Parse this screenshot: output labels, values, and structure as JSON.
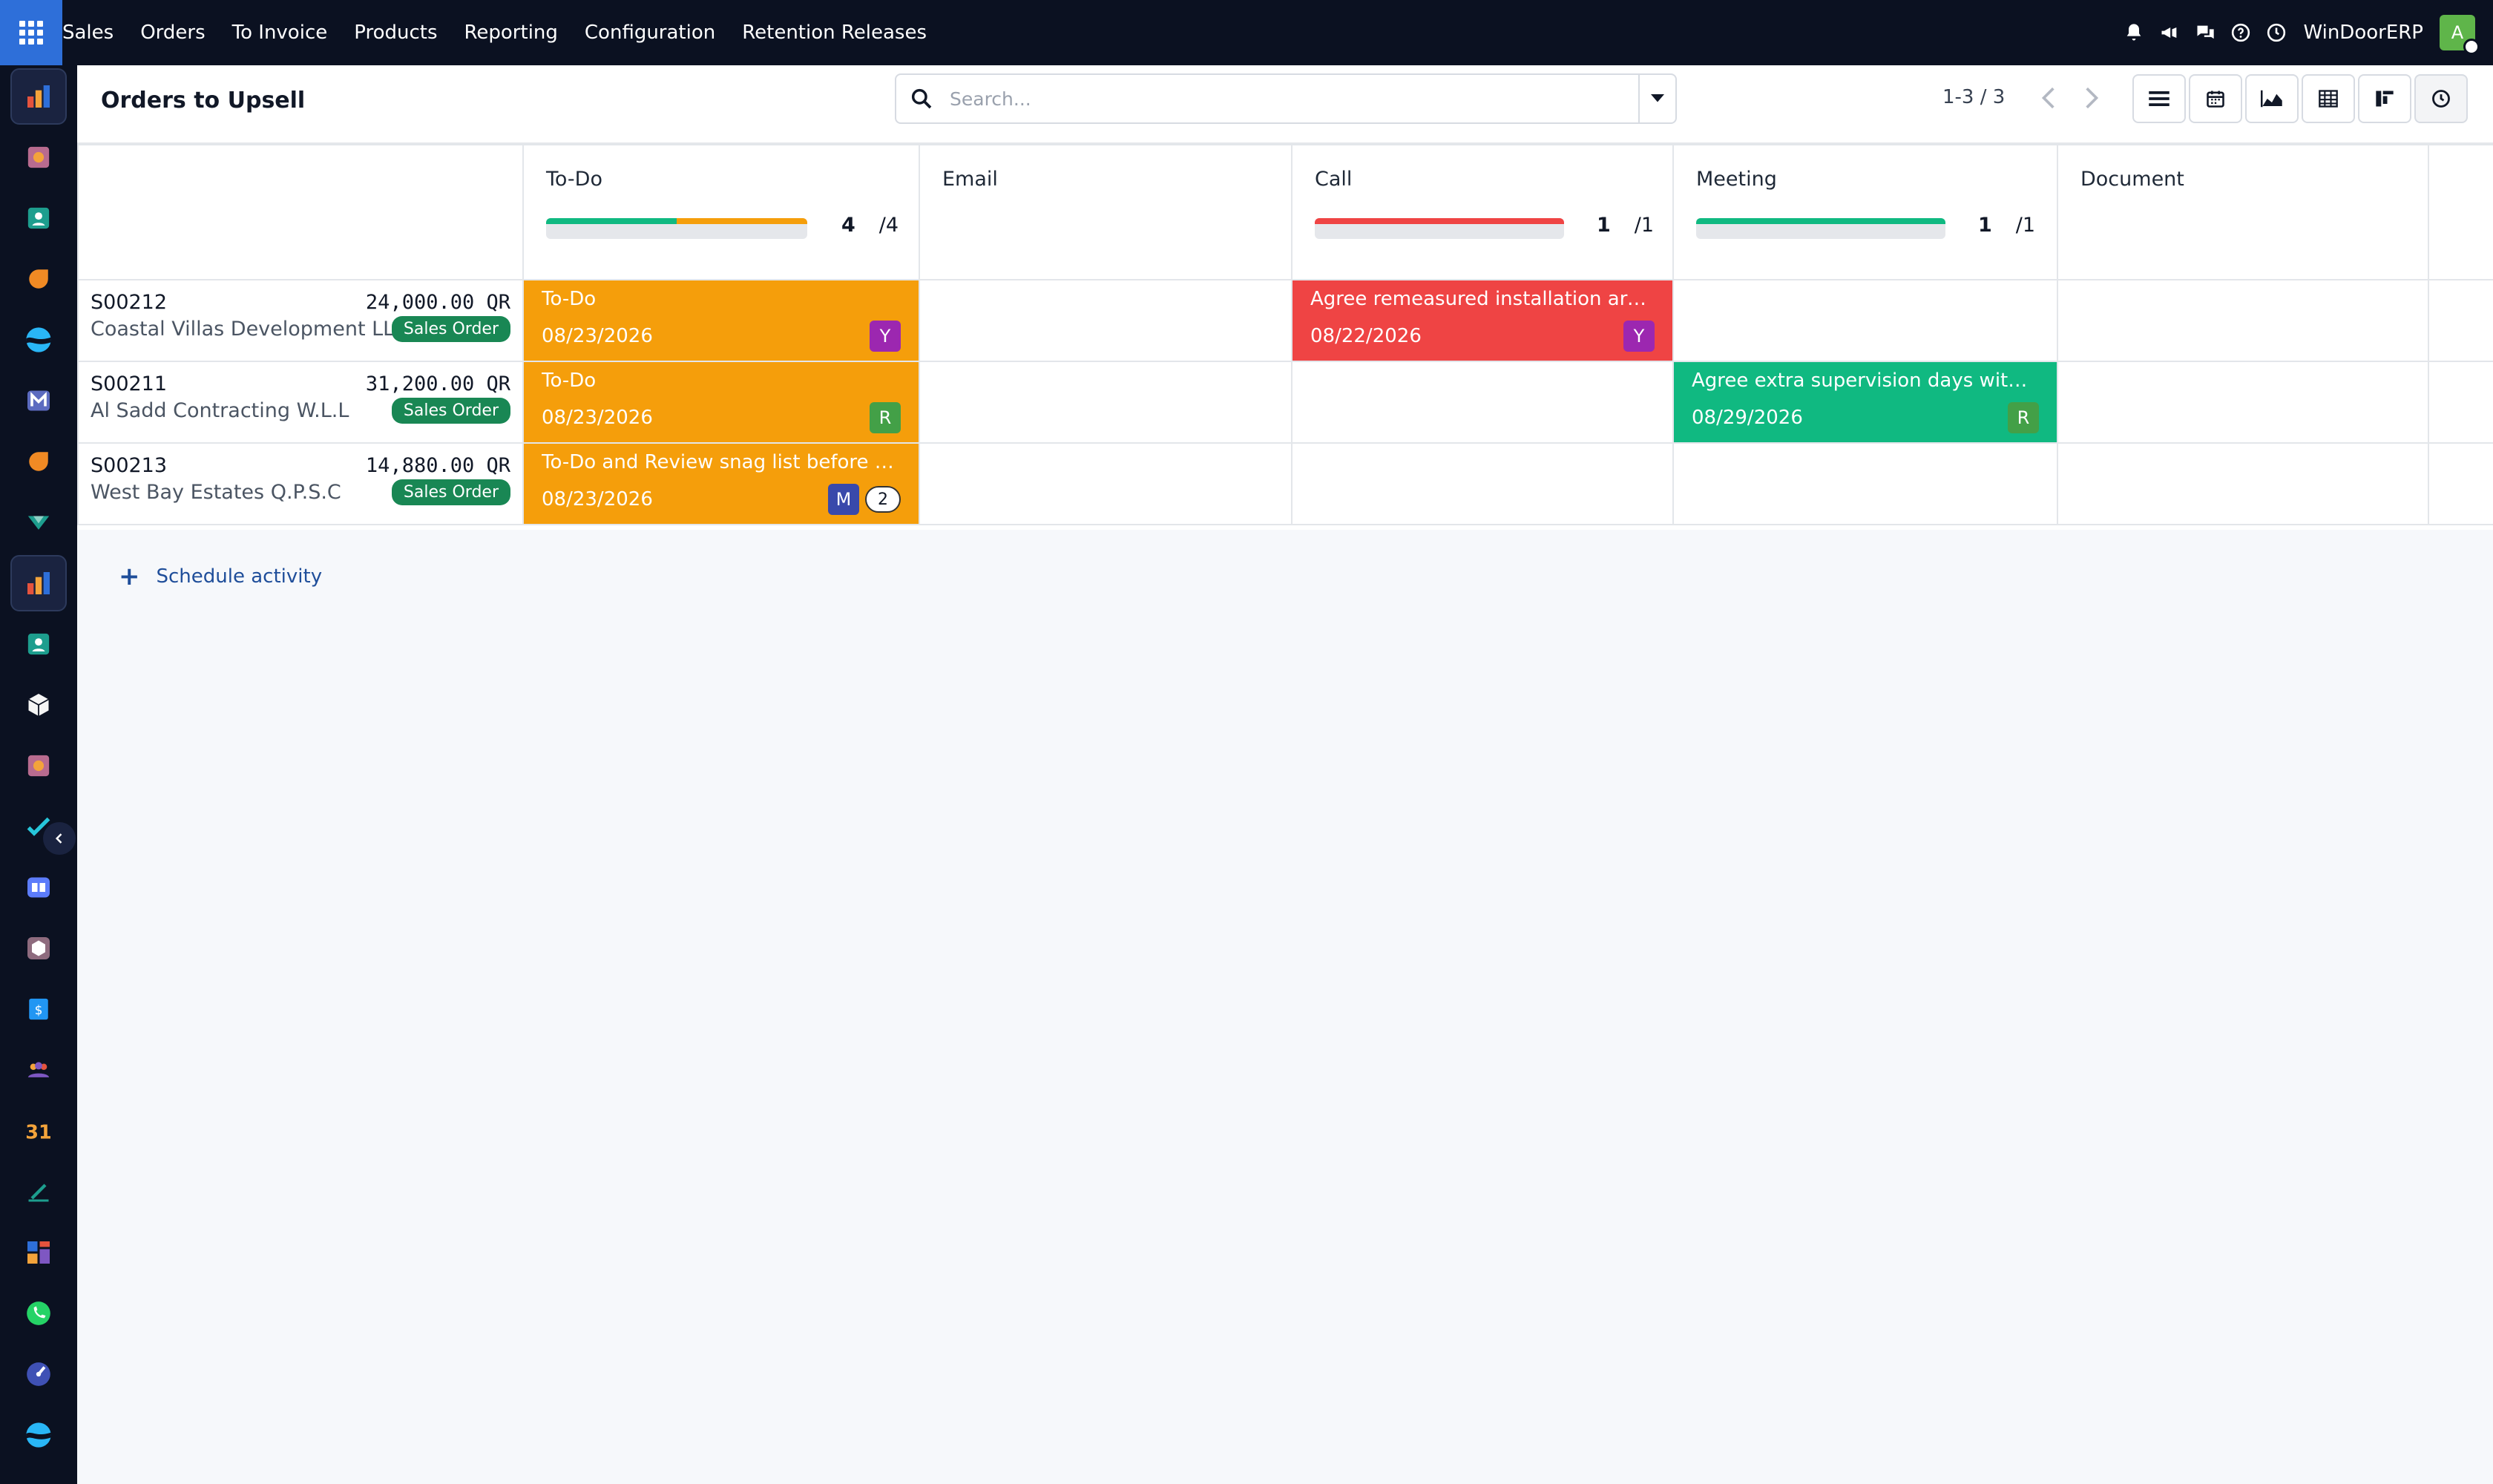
{
  "topbar": {
    "menu": [
      "Sales",
      "Orders",
      "To Invoice",
      "Products",
      "Reporting",
      "Configuration",
      "Retention Releases"
    ],
    "company": "WinDoorERP",
    "user_initial": "A"
  },
  "control": {
    "title": "Orders to Upsell",
    "search_placeholder": "Search...",
    "pager": "1-3 / 3"
  },
  "columns": [
    {
      "title": "To-Do",
      "done": "4",
      "total": "/4"
    },
    {
      "title": "Email"
    },
    {
      "title": "Call",
      "done": "1",
      "total": "/1"
    },
    {
      "title": "Meeting",
      "done": "1",
      "total": "/1"
    },
    {
      "title": "Document"
    }
  ],
  "rows": [
    {
      "name": "S00212",
      "amount": "24,000.00 QR",
      "partner": "Coastal Villas Development LLC",
      "badge": "Sales Order"
    },
    {
      "name": "S00211",
      "amount": "31,200.00 QR",
      "partner": "Al Sadd Contracting W.L.L",
      "badge": "Sales Order"
    },
    {
      "name": "S00213",
      "amount": "14,880.00 QR",
      "partner": "West Bay Estates Q.P.S.C",
      "badge": "Sales Order"
    }
  ],
  "activities": {
    "r0_todo": {
      "title": "To-Do",
      "date": "08/23/2026",
      "avatar": "Y"
    },
    "r0_call": {
      "title": "Agree remeasured installation area ...",
      "date": "08/22/2026",
      "avatar": "Y"
    },
    "r1_todo": {
      "title": "To-Do",
      "date": "08/23/2026",
      "avatar": "R"
    },
    "r1_meeting": {
      "title": "Agree extra supervision days with ...",
      "date": "08/29/2026",
      "avatar": "R"
    },
    "r2_todo": {
      "title": "To-Do and Review snag list before ta...",
      "date": "08/23/2026",
      "avatar": "M",
      "count": "2"
    }
  },
  "schedule_label": "Schedule activity",
  "colors": {
    "overdue_orange": "#f59e0b",
    "late_red": "#ef4444",
    "planned_green": "#10b981",
    "badge_green": "#198754"
  },
  "progress": {
    "todo_green_fraction": 0.5,
    "todo_orange_fraction": 0.5,
    "call_red_fraction": 1.0,
    "meeting_green_fraction": 1.0
  }
}
